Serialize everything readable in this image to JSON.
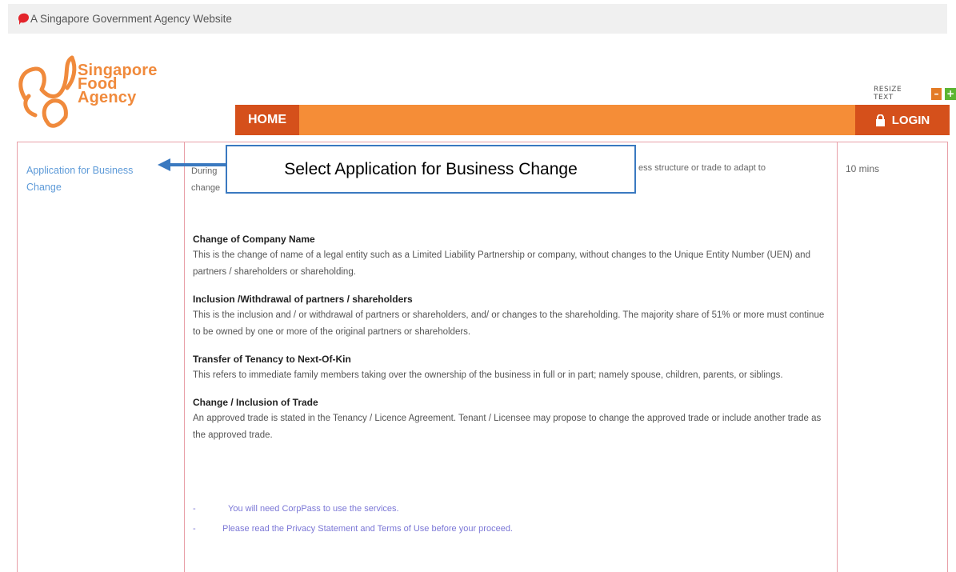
{
  "gov_bar": {
    "text": "A Singapore Government Agency Website"
  },
  "logo": {
    "line1": "Singapore",
    "line2": "Food",
    "line3": "Agency"
  },
  "resize": {
    "label": "RESIZE TEXT",
    "minus": "–",
    "plus": "+"
  },
  "nav": {
    "home": "HOME",
    "login": "LOGIN"
  },
  "service": {
    "name": "Application for Business Change",
    "duration": "10 mins",
    "intro_left": "During",
    "intro_left2": "change",
    "intro_right": "ess structure or trade to adapt to"
  },
  "callout": {
    "text": "Select Application for Business Change"
  },
  "sections": [
    {
      "title": "Change of Company Name",
      "body": "This is the change of name of a legal entity such as a Limited Liability Partnership or company, without changes to the Unique Entity Number (UEN) and partners / shareholders or shareholding."
    },
    {
      "title": "Inclusion /Withdrawal of partners / shareholders",
      "body": "This is the inclusion and / or withdrawal of partners or shareholders, and/ or changes to the shareholding. The majority share of 51% or more must continue to be owned by one or more of the original partners or shareholders."
    },
    {
      "title": "Transfer of Tenancy to Next-Of-Kin",
      "body": "This refers to immediate family members taking over the ownership of the business in full or in part; namely spouse, children, parents, or siblings."
    },
    {
      "title": "Change / Inclusion of Trade",
      "body": "An approved trade is stated in the Tenancy / Licence Agreement. Tenant / Licensee may propose to change the approved trade or include another trade as the approved trade."
    }
  ],
  "notes": [
    {
      "dash": "-",
      "text": "You will need CorpPass to use the services."
    },
    {
      "dash": "-",
      "text": "Please read the Privacy Statement and Terms of Use before your proceed."
    }
  ],
  "colors": {
    "accent": "#f58d37",
    "dark_accent": "#d5501b",
    "link": "#5d9ad8",
    "callout_border": "#3a79c0"
  }
}
